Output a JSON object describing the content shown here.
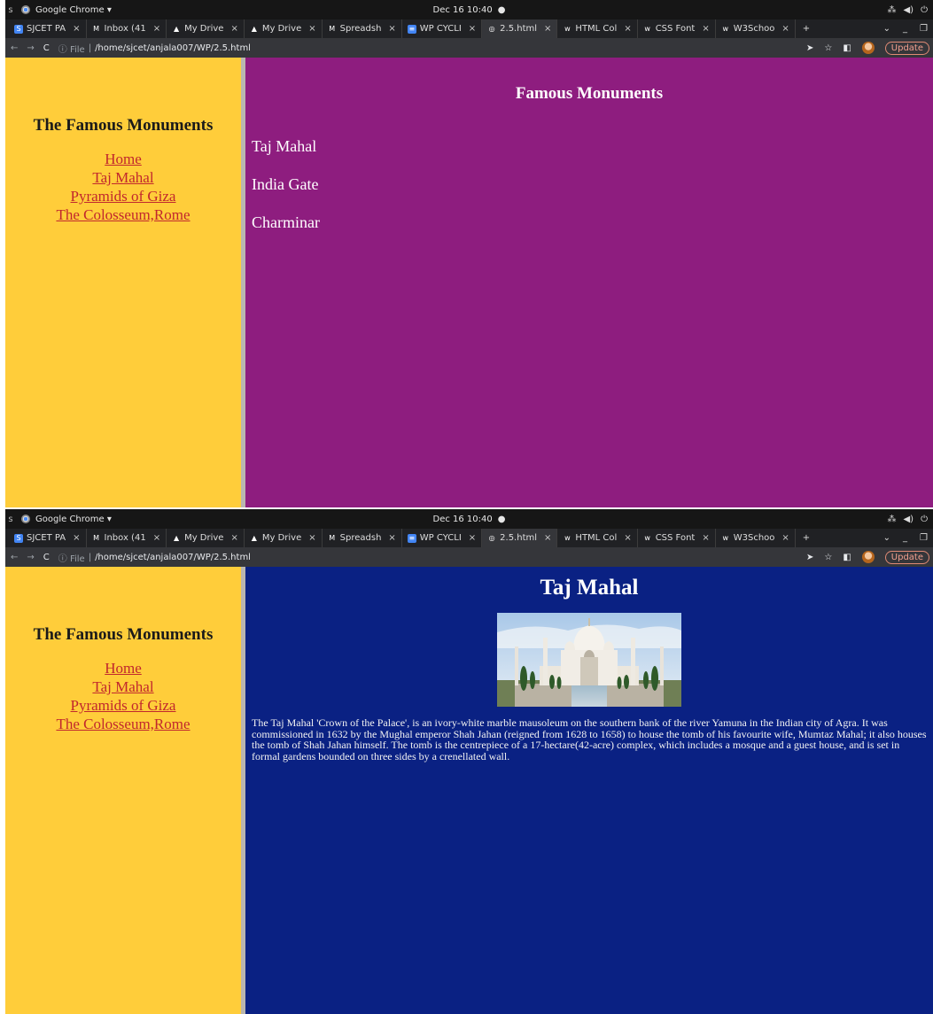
{
  "system_bar": {
    "s_letter": "s",
    "app_menu": "Google Chrome ▾",
    "datetime": "Dec 16  10:40",
    "record_dot": "●",
    "tray": [
      "network-icon",
      "volume-icon",
      "power-icon"
    ]
  },
  "tabs": [
    {
      "label": "SJCET PA",
      "icon_text": "S",
      "icon_color": "#4285f4",
      "active": false
    },
    {
      "label": "Inbox (41",
      "icon_text": "M",
      "icon_color": "#202124",
      "active": false
    },
    {
      "label": "My Drive",
      "icon_text": "▲",
      "icon_color": "#202124",
      "active": false
    },
    {
      "label": "My Drive",
      "icon_text": "▲",
      "icon_color": "#202124",
      "active": false
    },
    {
      "label": "Spreadsh",
      "icon_text": "M",
      "icon_color": "#202124",
      "active": false
    },
    {
      "label": "WP CYCLI",
      "icon_text": "≡",
      "icon_color": "#4285f4",
      "active": false
    },
    {
      "label": "2.5.html",
      "icon_text": "◎",
      "icon_color": "#35363a",
      "active": true
    },
    {
      "label": "HTML Col",
      "icon_text": "w",
      "icon_color": "#202124",
      "active": false
    },
    {
      "label": "CSS Font",
      "icon_text": "w",
      "icon_color": "#202124",
      "active": false
    },
    {
      "label": "W3Schoo",
      "icon_text": "w",
      "icon_color": "#202124",
      "active": false
    }
  ],
  "tab_close": "×",
  "new_tab": "+",
  "window_controls": {
    "list": "⌄",
    "minimize": "_",
    "restore": "❐"
  },
  "address": {
    "info_label": "ⓘ File",
    "url": "/home/sjcet/anjala007/WP/2.5.html",
    "update_label": "Update"
  },
  "sidebar": {
    "title": "The Famous Monuments",
    "links": [
      "Home",
      "Taj Mahal",
      "Pyramids of Giza",
      "The Colosseum,Rome"
    ]
  },
  "page1": {
    "heading": "Famous Monuments",
    "items": [
      "Taj Mahal",
      "India Gate",
      "Charminar"
    ]
  },
  "page2": {
    "heading": "Taj Mahal",
    "paragraph": "The Taj Mahal 'Crown of the Palace', is an ivory-white marble mausoleum on the southern bank of the river Yamuna in the Indian city of Agra. It was commissioned in 1632 by the Mughal emperor Shah Jahan (reigned from 1628 to 1658) to house the tomb of his favourite wife, Mumtaz Mahal; it also houses the tomb of Shah Jahan himself. The tomb is the centrepiece of a 17-hectare(42-acre) complex, which includes a mosque and a guest house, and is set in formal gardens bounded on three sides by a crenellated wall."
  },
  "colors": {
    "sidebar_bg": "#ffcd3a",
    "link": "#c1272d",
    "page1_bg": "#8e1d7f",
    "page2_bg": "#0a2183"
  }
}
